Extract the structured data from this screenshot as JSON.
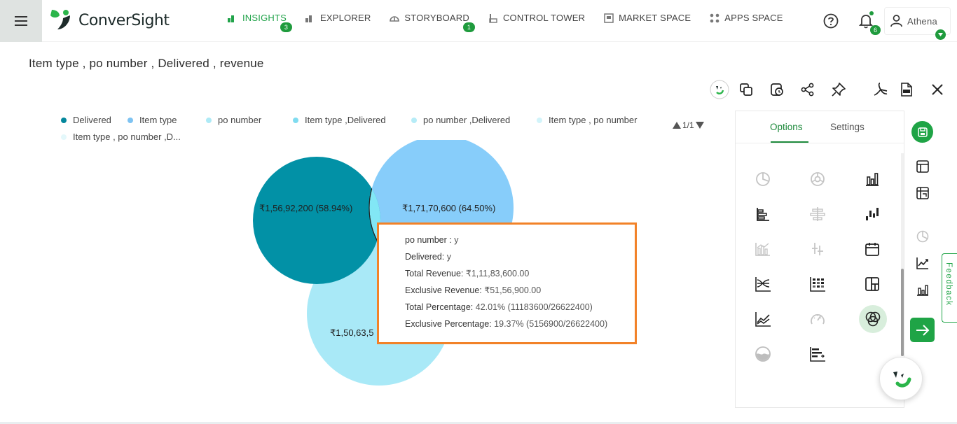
{
  "header": {
    "brand": "ConverSight",
    "nav": [
      {
        "label": "INSIGHTS",
        "badge": "3",
        "active": true
      },
      {
        "label": "EXPLORER"
      },
      {
        "label": "STORYBOARD",
        "badge": "1"
      },
      {
        "label": "CONTROL TOWER"
      },
      {
        "label": "MARKET SPACE"
      },
      {
        "label": "APPS SPACE"
      }
    ],
    "notifications_badge": "6",
    "user_name": "Athena"
  },
  "title": "Item type , po number , Delivered , revenue",
  "legend": {
    "items": [
      {
        "label": "Delivered",
        "color": "#04879c"
      },
      {
        "label": "Item type",
        "color": "#7ec3f2"
      },
      {
        "label": "po number",
        "color": "#aeeaf6"
      },
      {
        "label": "Item type  ,Delivered",
        "color": "#80dcf0"
      },
      {
        "label": "po number ,Delivered",
        "color": "#b6ecf7"
      },
      {
        "label": "Item type , po number",
        "color": "#d2f4fa"
      },
      {
        "label": "Item type , po number ,D...",
        "color": "#e4f8fb"
      }
    ],
    "pager": "1/1"
  },
  "venn": {
    "circles": [
      {
        "set": "Delivered",
        "label": "₹1,56,92,200 (58.94%)",
        "color": "#0291a6"
      },
      {
        "set": "Item type",
        "label": "₹1,71,70,600 (64.50%)",
        "color": "#87cdfa"
      },
      {
        "set": "po number",
        "label": "₹1,50,63,5",
        "color": "#a9e9f7"
      }
    ],
    "intersection_color": "#82e7f5"
  },
  "tooltip": {
    "rows": [
      {
        "key": "po number :",
        "value": " y"
      },
      {
        "key": "Delivered:",
        "value": " y"
      },
      {
        "key": "Total Revenue:",
        "value": " ₹1,11,83,600.00"
      },
      {
        "key": "Exclusive Revenue:",
        "value": " ₹51,56,900.00"
      },
      {
        "key": "Total Percentage:",
        "value": " 42.01% (11183600/26622400)"
      },
      {
        "key": "Exclusive Percentage:",
        "value": " 19.37% (5156900/26622400)"
      }
    ],
    "border_color": "#f28228"
  },
  "panel": {
    "tabs": [
      "Options",
      "Settings"
    ],
    "active_tab": "Options",
    "chart_types": [
      {
        "icon": "pie-chart-icon",
        "enabled": false
      },
      {
        "icon": "donut-chart-icon",
        "enabled": false
      },
      {
        "icon": "bar-chart-icon",
        "enabled": true
      },
      {
        "icon": "horizontal-bar-chart-icon",
        "enabled": true
      },
      {
        "icon": "diverging-bar-chart-icon",
        "enabled": false
      },
      {
        "icon": "waterfall-chart-icon",
        "enabled": true
      },
      {
        "icon": "combo-bar-line-chart-icon",
        "enabled": false
      },
      {
        "icon": "box-plot-icon",
        "enabled": false
      },
      {
        "icon": "calendar-chart-icon",
        "enabled": true
      },
      {
        "icon": "bump-chart-icon",
        "enabled": true
      },
      {
        "icon": "heatmap-chart-icon",
        "enabled": true
      },
      {
        "icon": "treemap-chart-icon",
        "enabled": true
      },
      {
        "icon": "multi-line-chart-icon",
        "enabled": true
      },
      {
        "icon": "gauge-chart-icon",
        "enabled": false
      },
      {
        "icon": "venn-chart-icon",
        "enabled": true,
        "selected": true
      },
      {
        "icon": "liquid-fill-chart-icon",
        "enabled": false
      },
      {
        "icon": "sorted-bar-chart-icon",
        "enabled": true
      }
    ]
  },
  "rail": {
    "feedback_label": "Feedback"
  },
  "colors": {
    "brand_green": "#1fa446",
    "nav_active": "#21a34a"
  }
}
